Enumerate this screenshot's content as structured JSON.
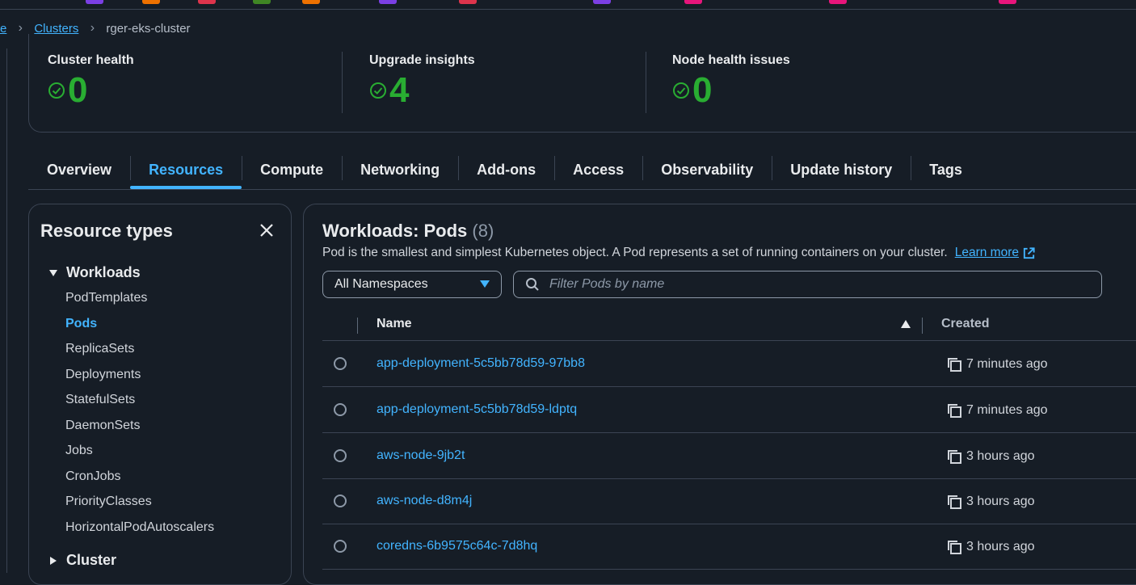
{
  "topbar": {
    "service_colors": [
      "#7b3fe4",
      "#ed7100",
      "#dd344c",
      "#3f8624",
      "#ed7100",
      "#7b3fe4",
      "#dd344c",
      "#7b3fe4",
      "#e7157b",
      "#e7157b",
      "#e7157b"
    ]
  },
  "breadcrumb": {
    "partial_link": "e",
    "clusters_link": "Clusters",
    "current": "rger-eks-cluster"
  },
  "health": {
    "cluster_health": {
      "label": "Cluster health",
      "value": "0"
    },
    "upgrade_insights": {
      "label": "Upgrade insights",
      "value": "4"
    },
    "node_health_issues": {
      "label": "Node health issues",
      "value": "0"
    },
    "status_color": "#29ad32"
  },
  "tabs": [
    {
      "label": "Overview",
      "active": false
    },
    {
      "label": "Resources",
      "active": true
    },
    {
      "label": "Compute",
      "active": false
    },
    {
      "label": "Networking",
      "active": false
    },
    {
      "label": "Add-ons",
      "active": false
    },
    {
      "label": "Access",
      "active": false
    },
    {
      "label": "Observability",
      "active": false
    },
    {
      "label": "Update history",
      "active": false
    },
    {
      "label": "Tags",
      "active": false
    }
  ],
  "resource_types": {
    "title": "Resource types",
    "workloads_group": "Workloads",
    "items": [
      "PodTemplates",
      "Pods",
      "ReplicaSets",
      "Deployments",
      "StatefulSets",
      "DaemonSets",
      "Jobs",
      "CronJobs",
      "PriorityClasses",
      "HorizontalPodAutoscalers"
    ],
    "active_item": "Pods",
    "cluster_group": "Cluster"
  },
  "workloads": {
    "title": "Workloads: Pods",
    "count": "(8)",
    "description": "Pod is the smallest and simplest Kubernetes object. A Pod represents a set of running containers on your cluster.",
    "learn_more": "Learn more",
    "namespace_select": "All Namespaces",
    "filter_placeholder": "Filter Pods by name",
    "columns": {
      "name": "Name",
      "created": "Created"
    },
    "rows": [
      {
        "name": "app-deployment-5c5bb78d59-97bb8",
        "created": "7 minutes ago"
      },
      {
        "name": "app-deployment-5c5bb78d59-ldptq",
        "created": "7 minutes ago"
      },
      {
        "name": "aws-node-9jb2t",
        "created": "3 hours ago"
      },
      {
        "name": "aws-node-d8m4j",
        "created": "3 hours ago"
      },
      {
        "name": "coredns-6b9575c64c-7d8hq",
        "created": "3 hours ago"
      }
    ]
  },
  "accent_color": "#42b4ff"
}
